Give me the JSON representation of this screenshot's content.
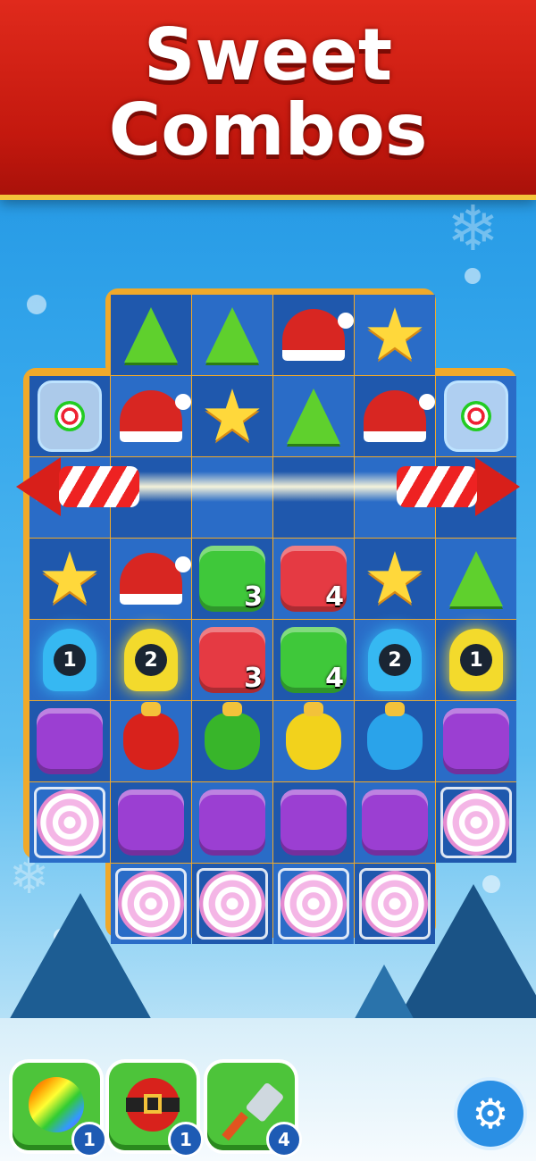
{
  "banner": {
    "line1": "Sweet",
    "line2": "Combos"
  },
  "board": {
    "rows": [
      [
        null,
        "tree",
        "tree",
        "hat",
        "star",
        null
      ],
      [
        "jar",
        "hat",
        "star",
        "tree",
        "hat",
        "jar"
      ],
      [
        null,
        null,
        null,
        null,
        null,
        null
      ],
      [
        "star",
        "hat",
        "jelly-green:3",
        "jelly-red:4",
        "star",
        "tree"
      ],
      [
        "lantern-blue:1",
        "lantern-yellow:2",
        "jelly-red:3",
        "jelly-green:4",
        "lantern-blue:2",
        "lantern-yellow:1"
      ],
      [
        "jelly-purple",
        "sack-red",
        "sack-green",
        "sack-yellow",
        "sack-blue",
        "jelly-purple"
      ],
      [
        "swirl",
        "jelly-purple",
        "jelly-purple",
        "jelly-purple",
        "jelly-purple",
        "swirl"
      ],
      [
        null,
        "swirl",
        "swirl",
        "swirl",
        "swirl",
        null
      ]
    ]
  },
  "boosters": [
    {
      "name": "striped-ornament-bomb",
      "count": "1"
    },
    {
      "name": "santa-belt-hammer",
      "count": "1"
    },
    {
      "name": "spatula",
      "count": "4"
    }
  ],
  "settings_icon": "gear-icon",
  "colors": {
    "banner": "#c3180e",
    "board_frame": "#f0a92a",
    "sky": "#36a8ec"
  }
}
